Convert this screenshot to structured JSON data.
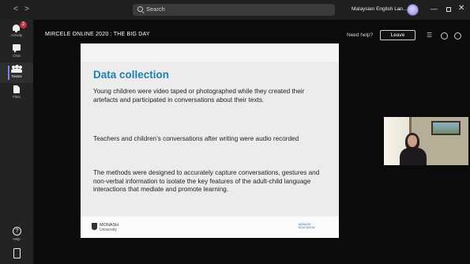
{
  "titlebar": {
    "back_glyph": "<",
    "forward_glyph": ">",
    "search_placeholder": "Search",
    "org_name": "Malaysian English Lan...",
    "org_caret": "⌄",
    "min_glyph": "—",
    "close_glyph": "✕"
  },
  "rail": {
    "items": [
      {
        "label": "Activity",
        "icon": "bell-icon",
        "badge": "2"
      },
      {
        "label": "Chat",
        "icon": "chat-icon"
      },
      {
        "label": "Teams",
        "icon": "teams-icon",
        "active": true
      },
      {
        "label": "Files",
        "icon": "file-icon"
      }
    ],
    "help": {
      "label": "Help",
      "icon": "help-icon",
      "glyph": "?"
    },
    "device_icon": "device-icon"
  },
  "meeting": {
    "title": "MIRCELE ONLINE 2020 : THE BIG DAY",
    "need_help": "Need help?",
    "leave_label": "Leave",
    "icons": [
      "layout-icon",
      "gear-icon",
      "more-icon"
    ],
    "layout_glyph": "☰"
  },
  "slide": {
    "title": "Data collection",
    "paragraphs": [
      "Young children were video taped or photographed while they created their artefacts and participated in conversations about their texts.",
      "Teachers and children’s conversations after writing were audio recorded",
      "The methods were designed to accurately capture conversations, gestures and non-verbal information to isolate the key features of the adult-child language interactions that mediate and promote learning."
    ],
    "footer_logo_line1": "MONASH",
    "footer_logo_line2": "University",
    "footer_brand_line1": "MONASH",
    "footer_brand_line2": "EDUCATION"
  },
  "colors": {
    "accent": "#7b83eb",
    "slide_title": "#1f7fae",
    "badge": "#c4314b"
  }
}
